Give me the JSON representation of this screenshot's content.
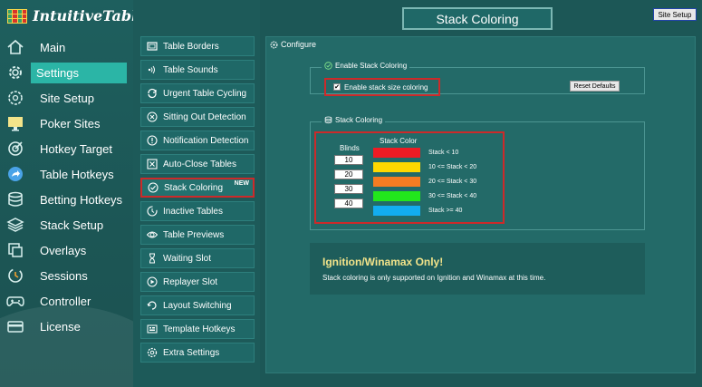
{
  "app": {
    "title": "IntuitiveTables"
  },
  "header": {
    "title": "Stack Coloring",
    "site_setup_button": "Site Setup"
  },
  "sidebar": {
    "items": [
      {
        "label": "Main",
        "icon": "home-icon",
        "active": false
      },
      {
        "label": "Settings",
        "icon": "gear-icon",
        "active": true
      },
      {
        "label": "Site Setup",
        "icon": "site-gear-icon",
        "active": false
      },
      {
        "label": "Poker Sites",
        "icon": "monitor-icon",
        "active": false
      },
      {
        "label": "Hotkey Target",
        "icon": "target-icon",
        "active": false
      },
      {
        "label": "Table Hotkeys",
        "icon": "share-arrow-icon",
        "active": false
      },
      {
        "label": "Betting Hotkeys",
        "icon": "database-icon",
        "active": false
      },
      {
        "label": "Stack Setup",
        "icon": "layers-icon",
        "active": false
      },
      {
        "label": "Overlays",
        "icon": "overlay-icon",
        "active": false
      },
      {
        "label": "Sessions",
        "icon": "session-icon",
        "active": false
      },
      {
        "label": "Controller",
        "icon": "gamepad-icon",
        "active": false
      },
      {
        "label": "License",
        "icon": "card-icon",
        "active": false
      }
    ]
  },
  "settings_menu": {
    "items": [
      {
        "label": "Table Borders",
        "icon": "borders-icon"
      },
      {
        "label": "Table Sounds",
        "icon": "sound-icon"
      },
      {
        "label": "Urgent Table Cycling",
        "icon": "cycle-icon"
      },
      {
        "label": "Sitting Out Detection",
        "icon": "sitting-out-icon"
      },
      {
        "label": "Notification Detection",
        "icon": "alert-icon"
      },
      {
        "label": "Auto-Close Tables",
        "icon": "close-box-icon"
      },
      {
        "label": "Stack Coloring",
        "icon": "check-circle-icon",
        "active": true,
        "badge": "NEW"
      },
      {
        "label": "Inactive Tables",
        "icon": "clock-icon"
      },
      {
        "label": "Table Previews",
        "icon": "eye-icon"
      },
      {
        "label": "Waiting Slot",
        "icon": "hourglass-icon"
      },
      {
        "label": "Replayer Slot",
        "icon": "replay-icon"
      },
      {
        "label": "Layout Switching",
        "icon": "layout-icon"
      },
      {
        "label": "Template Hotkeys",
        "icon": "template-icon"
      },
      {
        "label": "Extra Settings",
        "icon": "extra-gear-icon"
      }
    ]
  },
  "configure": {
    "title": "Configure",
    "enable_group": {
      "label": "Enable Stack Coloring",
      "checkbox_label": "Enable stack size coloring",
      "checked": true,
      "reset_button": "Reset Defaults"
    },
    "stack_group": {
      "label": "Stack Coloring",
      "blinds_header": "Blinds",
      "color_header": "Stack Color",
      "blinds": [
        "10",
        "20",
        "30",
        "40"
      ],
      "rows": [
        {
          "color": "#ee1c24",
          "label": "Stack < 10"
        },
        {
          "color": "#ffd800",
          "label": "10 <= Stack < 20"
        },
        {
          "color": "#f57c22",
          "label": "20 <= Stack < 30"
        },
        {
          "color": "#22e61c",
          "label": "30 <= Stack < 40"
        },
        {
          "color": "#12adf0",
          "label": "Stack >= 40"
        }
      ]
    },
    "notice": {
      "title": "Ignition/Winamax Only!",
      "text": "Stack coloring is only supported on Ignition and Winamax at this time."
    }
  },
  "colors": {
    "accent": "#2bb5a6",
    "highlight_border": "#cc2a2a",
    "notice_title": "#f3e48a"
  }
}
